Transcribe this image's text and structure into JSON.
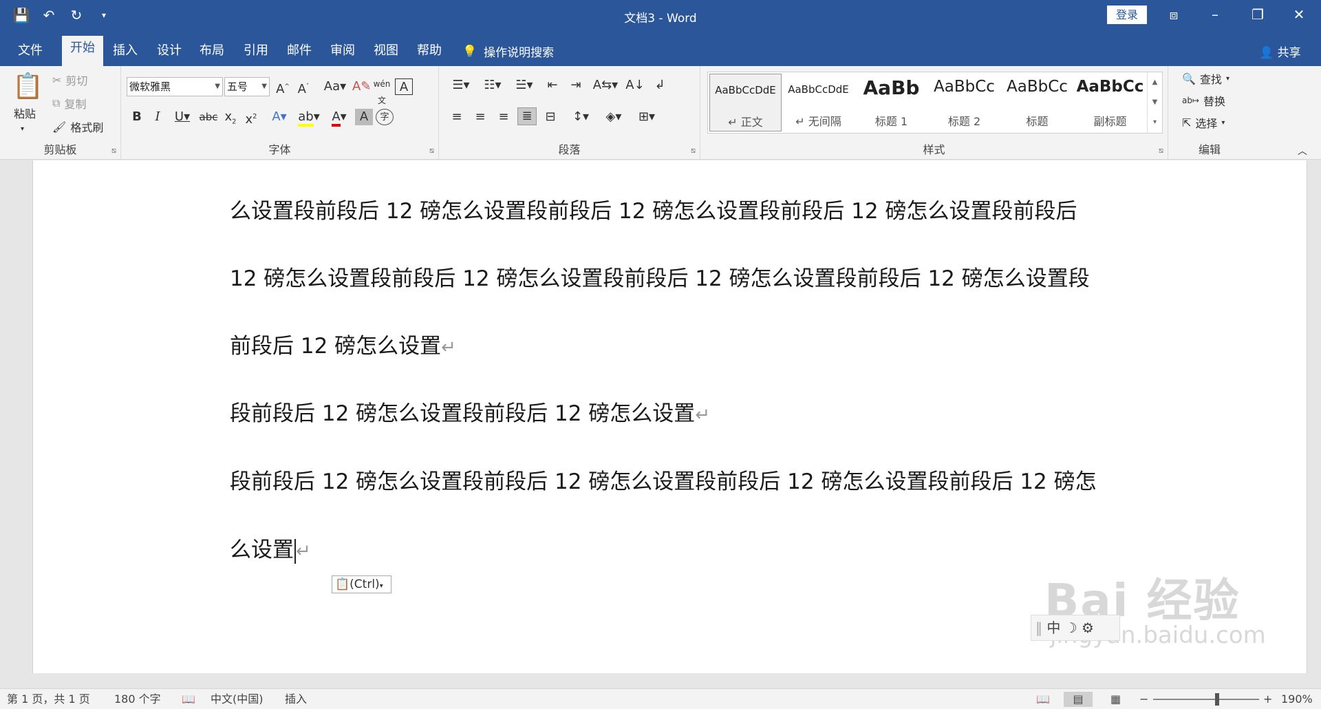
{
  "window": {
    "title": "文档3  -  Word",
    "login": "登录"
  },
  "qat": {
    "save_icon": "save-icon",
    "undo_icon": "undo-icon",
    "redo_icon": "redo-icon",
    "customize_icon": "customize-qat-icon"
  },
  "tabs": [
    "文件",
    "开始",
    "插入",
    "设计",
    "布局",
    "引用",
    "邮件",
    "审阅",
    "视图",
    "帮助"
  ],
  "active_tab": "开始",
  "tellme": "操作说明搜索",
  "share": "共享",
  "clipboard": {
    "paste": "粘贴",
    "cut": "剪切",
    "copy": "复制",
    "format_painter": "格式刷",
    "label": "剪贴板"
  },
  "font": {
    "name": "微软雅黑",
    "size": "五号",
    "label": "字体"
  },
  "paragraph": {
    "label": "段落"
  },
  "styles": {
    "label": "样式",
    "items": [
      {
        "preview": "AaBbCcDdE",
        "name": "↵ 正文"
      },
      {
        "preview": "AaBbCcDdE",
        "name": "↵ 无间隔"
      },
      {
        "preview": "AaBb",
        "name": "标题 1"
      },
      {
        "preview": "AaBbCc",
        "name": "标题 2"
      },
      {
        "preview": "AaBbCc",
        "name": "标题"
      },
      {
        "preview": "AaBbCc",
        "name": "副标题"
      }
    ]
  },
  "editing": {
    "find": "查找",
    "replace": "替换",
    "select": "选择",
    "label": "编辑"
  },
  "document": {
    "lines": [
      "么设置段前段后 12 磅怎么设置段前段后 12 磅怎么设置段前段后 12 磅怎么设置段前段后",
      "12 磅怎么设置段前段后 12 磅怎么设置段前段后 12 磅怎么设置段前段后 12 磅怎么设置段",
      "前段后 12 磅怎么设置",
      "段前段后 12 磅怎么设置段前段后 12 磅怎么设置",
      "段前段后 12 磅怎么设置段前段后 12 磅怎么设置段前段后 12 磅怎么设置段前段后 12 磅怎",
      "么设置"
    ],
    "paste_options": "(Ctrl)",
    "ime": "中"
  },
  "watermark": {
    "main": "Bai 经验",
    "sub": "jingyan.baidu.com"
  },
  "status": {
    "page": "第 1 页，共 1 页",
    "words": "180 个字",
    "language": "中文(中国)",
    "mode": "插入",
    "zoom": "190%"
  }
}
